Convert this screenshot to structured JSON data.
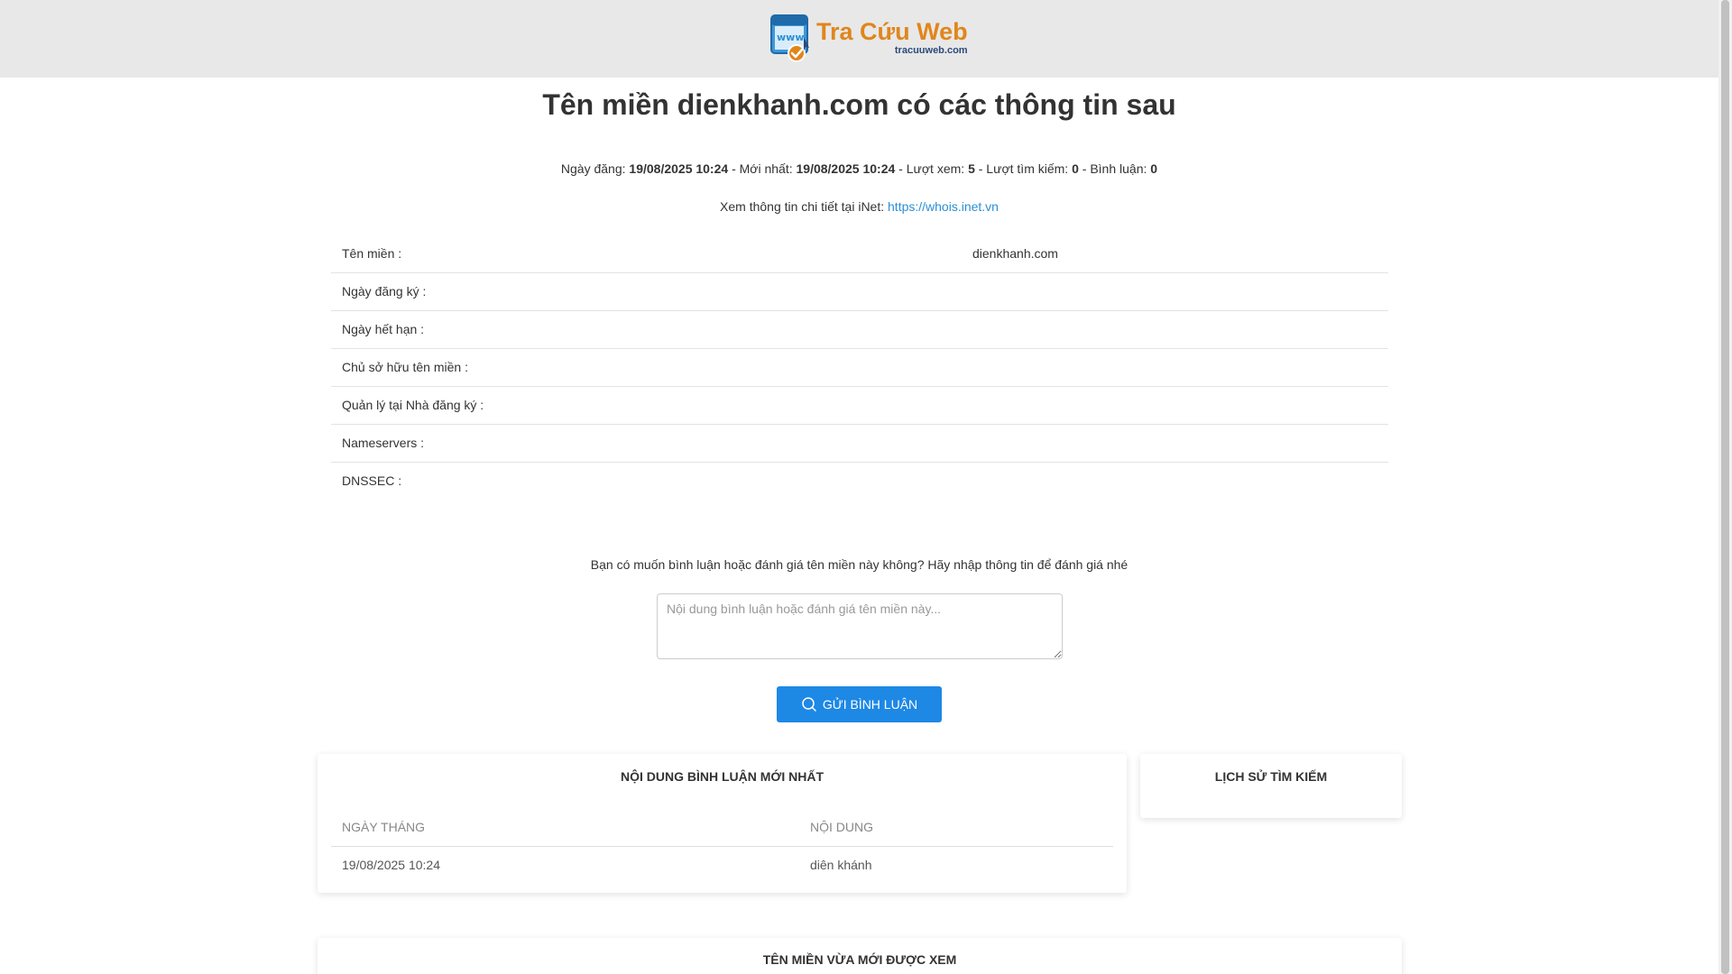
{
  "brand": {
    "title": "Tra Cứu Web",
    "subtitle": "tracuuweb.com",
    "icon_text": "www",
    "colors": {
      "title": "#e0861b",
      "subtitle": "#2c4a7a",
      "icon_blue": "#2a8fd6",
      "check": "#e0861b"
    }
  },
  "heading": {
    "prefix": "Tên miền",
    "domain": "dienkhanh.com",
    "suffix": "có các thông tin sau"
  },
  "meta": {
    "posted_label": "Ngày đăng:",
    "posted_value": "19/08/2025 10:24",
    "latest_label": "- Mới nhất:",
    "latest_value": "19/08/2025 10:24",
    "views_label": "- Lượt xem:",
    "views_value": "5",
    "searches_label": "- Lượt tìm kiếm:",
    "searches_value": "0",
    "comments_label": "- Bình luận:",
    "comments_value": "0"
  },
  "inet": {
    "label": "Xem thông tin chi tiết tại iNet:",
    "link": "https://whois.inet.vn"
  },
  "whois": [
    {
      "key": "Tên miền :",
      "value": "dienkhanh.com"
    },
    {
      "key": "Ngày đăng ký :",
      "value": ""
    },
    {
      "key": "Ngày hết hạn :",
      "value": ""
    },
    {
      "key": "Chủ sở hữu tên miền :",
      "value": ""
    },
    {
      "key": "Quản lý tại Nhà đăng ký :",
      "value": ""
    },
    {
      "key": "Nameservers :",
      "value": ""
    },
    {
      "key": "DNSSEC :",
      "value": ""
    }
  ],
  "comment_form": {
    "prompt": "Bạn có muốn bình luận hoặc đánh giá tên miền này không? Hãy nhập thông tin để đánh giá nhé",
    "placeholder": "Nội dung bình luận hoặc đánh giá tên miền này...",
    "value": "",
    "submit_label": "GỬI BÌNH LUẬN",
    "submit_icon": "search-icon",
    "button_color": "#1e88e5"
  },
  "latest_comments": {
    "title": "NỘI DUNG BÌNH LUẬN MỚI NHẤT",
    "columns": [
      "NGÀY THÁNG",
      "NỘI DUNG"
    ],
    "rows": [
      {
        "date": "19/08/2025 10:24",
        "content": "diên khánh"
      }
    ]
  },
  "search_history": {
    "title": "LỊCH SỬ TÌM KIẾM"
  },
  "recently_viewed": {
    "title": "TÊN MIỀN VỪA MỚI ĐƯỢC XEM"
  }
}
